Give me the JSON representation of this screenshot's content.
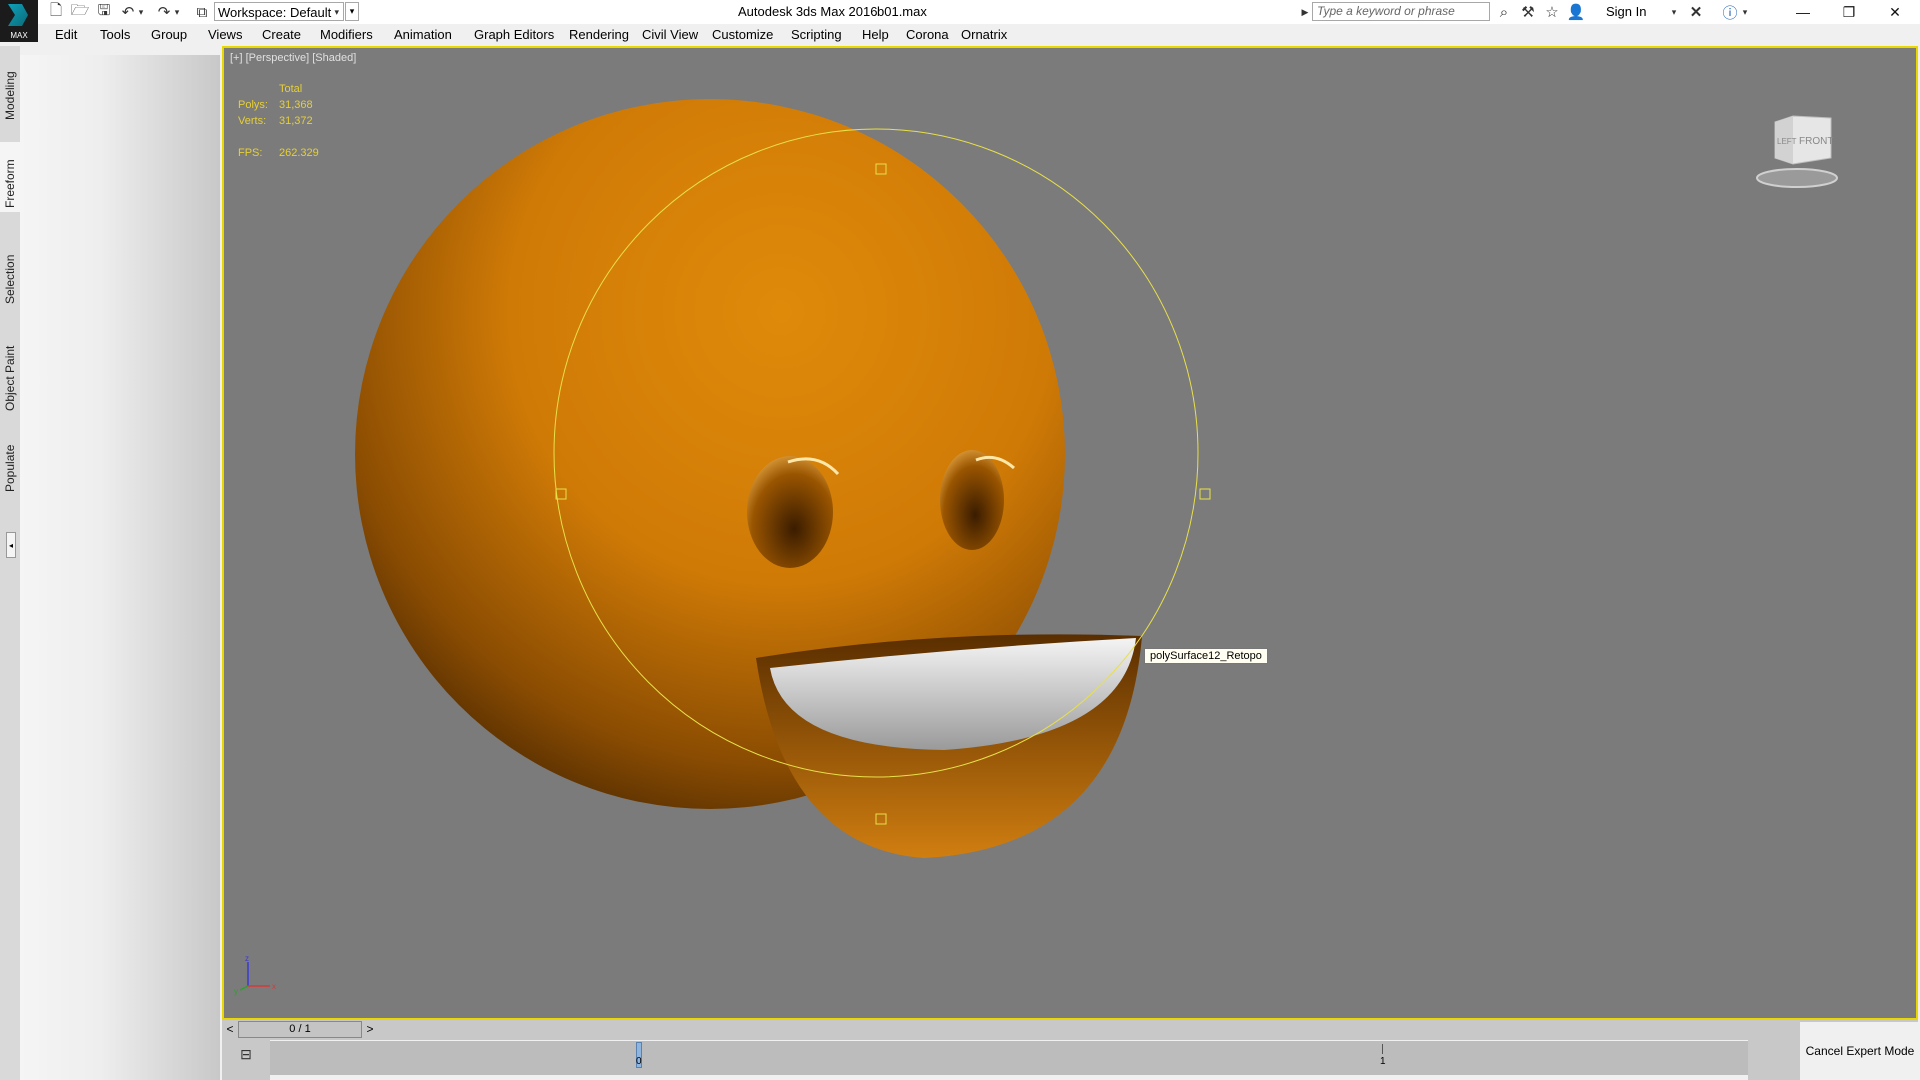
{
  "titlebar": {
    "logo_text": "MAX",
    "workspace_value": "Workspace: Default",
    "app_title": "Autodesk 3ds Max 2016",
    "file_name": "b01.max",
    "search_placeholder": "Type a keyword or phrase",
    "sign_in": "Sign In"
  },
  "menu": [
    "Edit",
    "Tools",
    "Group",
    "Views",
    "Create",
    "Modifiers",
    "Animation",
    "Graph Editors",
    "Rendering",
    "Civil View",
    "Customize",
    "Scripting",
    "Help",
    "Corona",
    "Ornatrix"
  ],
  "ribbon_tabs": [
    "Modeling",
    "Freeform",
    "Selection",
    "Object Paint",
    "Populate"
  ],
  "viewport": {
    "label": "[+] [Perspective] [Shaded]",
    "stats": {
      "header": "Total",
      "polys_label": "Polys:",
      "polys_value": "31,368",
      "verts_label": "Verts:",
      "verts_value": "31,372",
      "fps_label": "FPS:",
      "fps_value": "262.329"
    },
    "tooltip": "polySurface12_Retopo",
    "viewcube_left": "LEFT",
    "viewcube_front": "FRONT",
    "axis_x": "x",
    "axis_z": "z",
    "axis_y": "y"
  },
  "timeline": {
    "slider_value": "0 / 1",
    "prev": "<",
    "next": ">",
    "tick_0": "0",
    "tick_1": "1"
  },
  "expert_mode": "Cancel Expert Mode",
  "colors": {
    "viewport_bg": "#7b7b7b",
    "active_border": "#e8d700",
    "stats_text": "#e6cf35",
    "sphere": "#d98306"
  }
}
